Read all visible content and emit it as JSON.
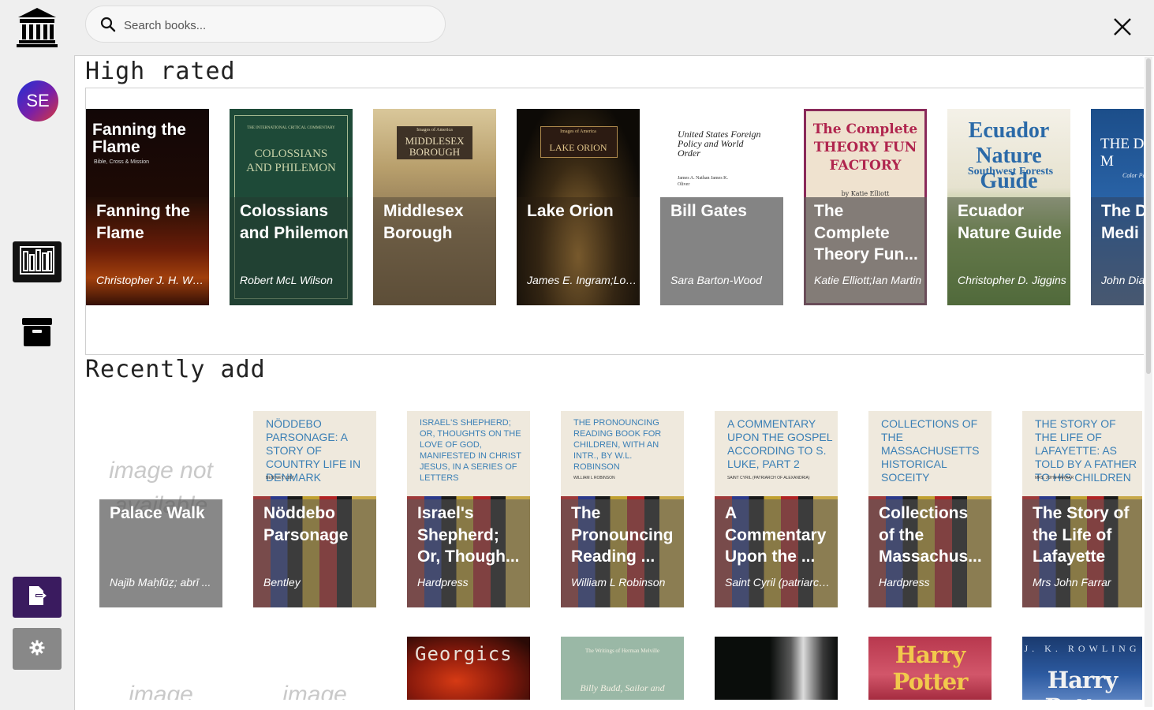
{
  "search": {
    "placeholder": "Search books..."
  },
  "user": {
    "initials": "SE"
  },
  "icons": {
    "logo": "library-building-icon",
    "library": "bookshelf-icon",
    "archive": "archive-box-icon",
    "export": "export-file-icon",
    "settings": "gear-icon",
    "close": "close-icon",
    "search": "search-icon"
  },
  "colors": {
    "export_button": "#3a1b5f",
    "library_button": "#121212",
    "settings_button": "#888888"
  },
  "high_rated": {
    "title": "High rated",
    "books": [
      {
        "title": "Fanning the Flame",
        "author": "Christopher J. H. Wright",
        "cover_text": "Fanning the Flame",
        "cover_subtext": "Bible, Cross & Mission"
      },
      {
        "title": "Colossians and Philemon",
        "author": "Robert McL Wilson",
        "cover_text": "COLOSSIANS AND PHILEMON",
        "cover_subtext": "THE INTERNATIONAL CRITICAL COMMENTARY"
      },
      {
        "title": "Middlesex Borough",
        "author": "",
        "cover_text": "MIDDLESEX BOROUGH",
        "cover_subtext": "Images of America"
      },
      {
        "title": "Lake Orion",
        "author": "James E. Ingram;Lori ...",
        "cover_text": "LAKE ORION",
        "cover_subtext": "Images of America"
      },
      {
        "title": "Bill Gates",
        "author": "Sara Barton-Wood",
        "cover_text": "United States Foreign Policy and World Order",
        "cover_subtext": "James A. Nathan James K. Oliver"
      },
      {
        "title": "The Complete Theory Fun...",
        "author": "Katie Elliott;Ian Martin",
        "cover_text": "The Complete THEORY FUN FACTORY",
        "cover_subtext": "by Katie Elliott"
      },
      {
        "title": "Ecuador Nature Guide",
        "author": "Christopher D. Jiggins",
        "cover_text": "Ecuador Nature Guide",
        "cover_subtext": "Southwest Forests"
      },
      {
        "title": "The D Color Medi",
        "author": "John Diar",
        "cover_text": "THE D COLOR M",
        "cover_subtext": "Color Path"
      }
    ]
  },
  "recently_added": {
    "title": "Recently add",
    "books": [
      {
        "title": "Palace Walk",
        "author": "Najīb Maḥfūẓ;  abrī   ...",
        "placeholder": "image not available"
      },
      {
        "title": "Nöddebo Parsonage",
        "author": "Bentley",
        "cover_text": "NÖDDEBO PARSONAGE: A STORY OF COUNTRY LIFE IN DENMARK",
        "cover_subtext": "BENTLEY, 1867"
      },
      {
        "title": "Israel's Shepherd; Or, Though...",
        "author": "Hardpress",
        "cover_text": "ISRAEL'S SHEPHERD; OR, THOUGHTS ON THE LOVE OF GOD, MANIFESTED IN CHRIST JESUS, IN A SERIES OF LETTERS",
        "cover_subtext": ""
      },
      {
        "title": "The Pronouncing Reading ...",
        "author": "William L Robinson",
        "cover_text": "THE PRONOUNCING READING BOOK FOR CHILDREN, WITH AN INTR., BY W.L. ROBINSON",
        "cover_subtext": "WILLIAM L ROBINSON"
      },
      {
        "title": "A Commentary Upon the ...",
        "author": "Saint Cyril (patriarch ...",
        "cover_text": "A COMMENTARY UPON THE GOSPEL ACCORDING TO S. LUKE, PART 2",
        "cover_subtext": "SAINT CYRIL (PATRIARCH OF ALEXANDRIA)"
      },
      {
        "title": "Collections of the Massachus...",
        "author": "Hardpress",
        "cover_text": "COLLECTIONS OF THE MASSACHUSETTS HISTORICAL SOCEITY",
        "cover_subtext": ""
      },
      {
        "title": "The Story of the Life of Lafayette",
        "author": "Mrs John Farrar",
        "cover_text": "THE STORY OF THE LIFE OF LAFAYETTE: AS TOLD BY A FATHER TO HIS CHILDREN",
        "cover_subtext": "MRS. JOHN FARRAR"
      }
    ]
  },
  "more_books": [
    {
      "placeholder": "image"
    },
    {
      "placeholder": "image"
    },
    {
      "cover_text": "Georgics"
    },
    {
      "cover_text": "The Writings of Herman Melville",
      "cover_subtext": "Billy Budd, Sailor and"
    },
    {
      "cover_text": ""
    },
    {
      "cover_text": "Harry Potter"
    },
    {
      "cover_text": "Harry Potter",
      "cover_subtext": "J. K. ROWLING"
    }
  ]
}
